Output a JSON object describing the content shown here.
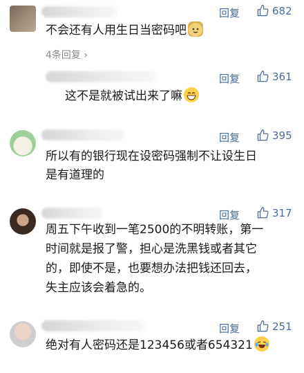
{
  "comments": [
    {
      "reply_label": "回复",
      "likes": "682",
      "lines": [
        "不会还有人用生日当密码吧"
      ],
      "emoji": "cat-emoji",
      "more_replies": "4条回复 ›"
    },
    {
      "reply_label": "回复",
      "likes": "361",
      "lines": [
        "这不是就被试出来了嘛"
      ],
      "emoji": "grin-emoji"
    },
    {
      "reply_label": "回复",
      "likes": "395",
      "lines": [
        "所以有的银行现在设密码强制不让设生日",
        "是有道理的"
      ]
    },
    {
      "reply_label": "回复",
      "likes": "317",
      "lines": [
        "周五下午收到一笔2500的不明转账，第一",
        "时间就是报了警，担心是洗黑钱或者其它",
        "的，即使不是，也要想办法把钱还回去，",
        "失主应该会着急的。"
      ]
    },
    {
      "reply_label": "回复",
      "likes": "251",
      "lines": [
        "绝对有人密码还是123456或者654321"
      ],
      "emoji": "laugh-cry-emoji"
    }
  ],
  "colors": {
    "action": "#4a6a9a",
    "text": "#1a1a1a",
    "muted": "#8a8a8a"
  }
}
